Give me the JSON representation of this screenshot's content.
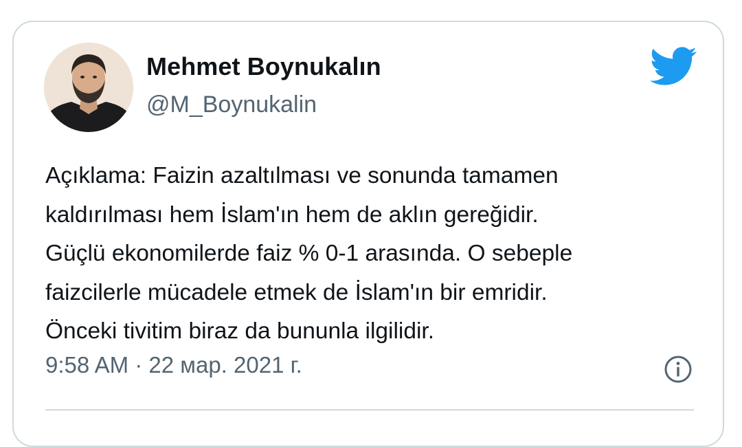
{
  "tweet": {
    "author": {
      "display_name": "Mehmet Boynukalın",
      "handle": "@M_Boynukalin"
    },
    "text_lines": [
      "Açıklama: Faizin azaltılması ve sonunda tamamen",
      "kaldırılması hem İslam'ın hem de aklın gereğidir.",
      "Güçlü ekonomilerde faiz % 0-1 arasında. O sebeple",
      "faizcilerle mücadele etmek de İslam'ın bir emridir.",
      "Önceki tivitim biraz da bununla ilgilidir."
    ],
    "timestamp": "9:58 AM · 22 мар. 2021 г."
  },
  "icons": {
    "brand": "twitter-bird-icon",
    "info": "info-icon"
  },
  "colors": {
    "twitter_blue": "#1d9bf0",
    "text_primary": "#0f1419",
    "text_secondary": "#536471",
    "border": "#cfd9de"
  }
}
